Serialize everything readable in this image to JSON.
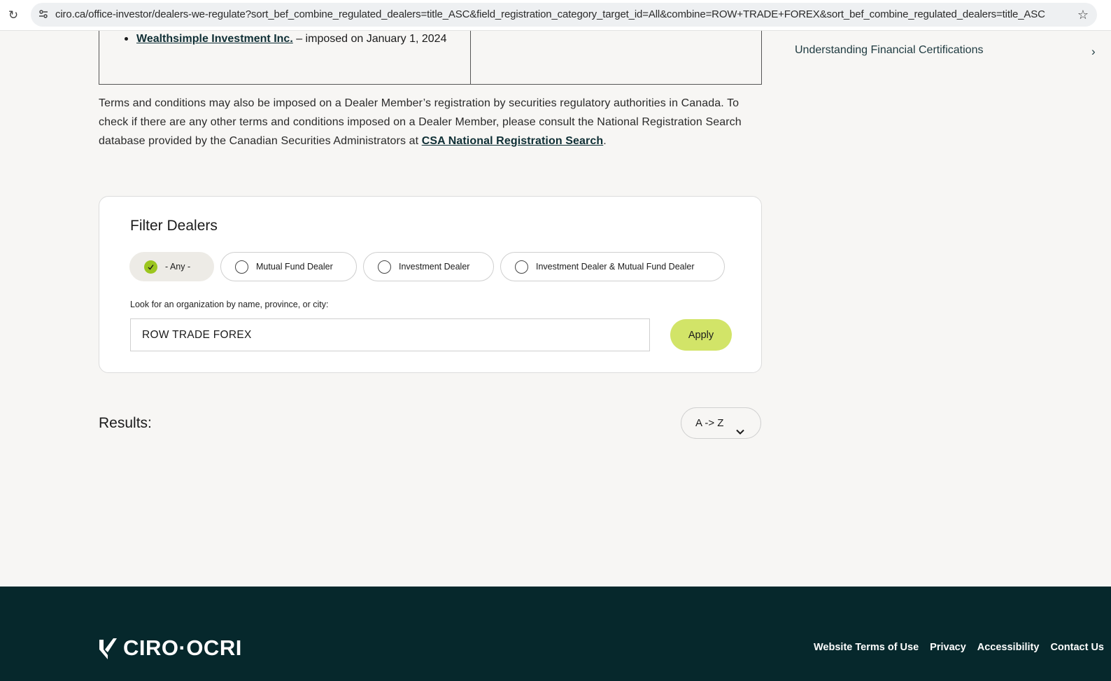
{
  "browser": {
    "url": "ciro.ca/office-investor/dealers-we-regulate?sort_bef_combine_regulated_dealers=title_ASC&field_registration_category_target_id=All&combine=ROW+TRADE+FOREX&sort_bef_combine_regulated_dealers=title_ASC"
  },
  "terms_table": {
    "items": [
      {
        "dealer": "Wealthsimple Investment Inc.",
        "note": " – imposed on January 1, 2024"
      }
    ]
  },
  "sidebar": {
    "link": "Understanding Financial Certifications"
  },
  "paragraph": {
    "text": "Terms and conditions may also be imposed on a Dealer Member’s registration by securities regulatory authorities in Canada. To check if there are any other terms and conditions imposed on a Dealer Member, please consult the National Registration Search database provided by the Canadian Securities Administrators at ",
    "link": "CSA National Registration Search",
    "end": "."
  },
  "filter": {
    "title": "Filter Dealers",
    "options": [
      {
        "label": "- Any -",
        "selected": true
      },
      {
        "label": "Mutual Fund Dealer",
        "selected": false
      },
      {
        "label": "Investment Dealer",
        "selected": false
      },
      {
        "label": "Investment Dealer & Mutual Fund Dealer",
        "selected": false
      }
    ],
    "search_label": "Look for an organization by name, province, or city:",
    "search_value": "ROW TRADE FOREX",
    "apply_label": "Apply"
  },
  "results": {
    "label": "Results:",
    "sort_value": "A -> Z"
  },
  "footer": {
    "logo_text": "CIRO·OCRI",
    "links": [
      "Website Terms of Use",
      "Privacy",
      "Accessibility",
      "Contact Us"
    ]
  },
  "colors": {
    "accent_green": "#d2e468",
    "check_green": "#9cc61f",
    "footer_bg": "#06282c",
    "link_dark": "#0f2f35"
  }
}
